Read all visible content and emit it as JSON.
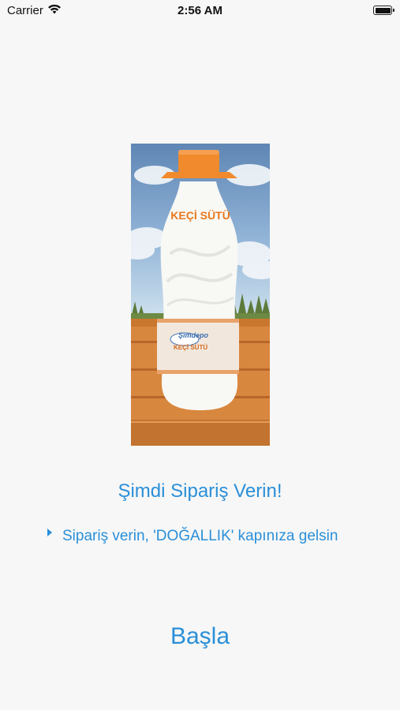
{
  "status_bar": {
    "carrier": "Carrier",
    "time": "2:56 AM"
  },
  "product": {
    "label_top": "KEÇİ SÜTÜ",
    "brand": "Şimdepo",
    "label_bottom": "KEÇİ SÜTÜ",
    "colors": {
      "cap": "#f08a2c",
      "label_text": "#e8781e",
      "bottle": "#f8f8f5",
      "wood": "#d8873e"
    }
  },
  "headline": "Şimdi Sipariş Verin!",
  "bullets": [
    "Sipariş verin, 'DOĞALLIK' kapınıza gelsin"
  ],
  "start_button": "Başla",
  "theme": {
    "accent": "#2a8fd8",
    "background": "#f7f7f7"
  }
}
